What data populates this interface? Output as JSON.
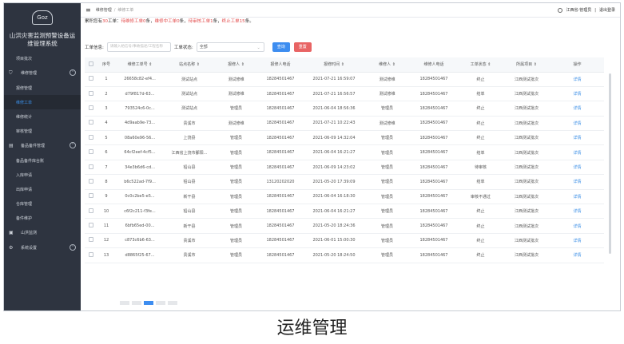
{
  "app": {
    "logo_text": "Goz",
    "system_title": "山洪灾害监测预警设备运维管理系统"
  },
  "sidebar": {
    "items": [
      {
        "label": "项目批次",
        "type": "sub",
        "icon": ""
      },
      {
        "label": "维修管理",
        "type": "group",
        "icon": "shield-icon"
      },
      {
        "label": "报修管理",
        "type": "sub",
        "icon": ""
      },
      {
        "label": "维修工单",
        "type": "sub",
        "icon": "",
        "active": true
      },
      {
        "label": "维修统计",
        "type": "sub",
        "icon": ""
      },
      {
        "label": "审核管理",
        "type": "sub",
        "icon": ""
      },
      {
        "label": "备品备件管理",
        "type": "group",
        "icon": "clipboard-icon"
      },
      {
        "label": "备品备件库台账",
        "type": "sub",
        "icon": ""
      },
      {
        "label": "入库申请",
        "type": "sub",
        "icon": ""
      },
      {
        "label": "出库申请",
        "type": "sub",
        "icon": ""
      },
      {
        "label": "仓库管理",
        "type": "sub",
        "icon": ""
      },
      {
        "label": "备件维护",
        "type": "sub",
        "icon": ""
      },
      {
        "label": "山洪监测",
        "type": "group",
        "icon": "monitor-icon"
      },
      {
        "label": "系统设置",
        "type": "group",
        "icon": "settings-icon"
      }
    ]
  },
  "topbar": {
    "breadcrumb": [
      "维修管理",
      "维修工单"
    ],
    "user": "江西省-管理员",
    "logout": "退出登录"
  },
  "stats": {
    "prefix": "累积您有",
    "total": "30",
    "t1": "工单：",
    "pending_label": "待维修工单",
    "pending_val": "0",
    "repairing_label": "维修中工单",
    "repairing_val": "0",
    "review_label": "待审核工单",
    "review_val": "1",
    "stopped_label": "终止工单",
    "stopped_val": "15",
    "unit": "条",
    "sep": "，"
  },
  "filter": {
    "order_label": "工单信息:",
    "order_placeholder": "请输入始信号/事故描述/工程名称",
    "status_label": "工单状态:",
    "status_value": "全部",
    "search_btn": "查询",
    "reset_btn": "重置"
  },
  "table": {
    "columns": [
      "",
      "序号",
      "维修工单号 ⇕",
      "站点名称 ⇕",
      "报修人 ⇕",
      "报修人电话",
      "报修时间 ⇕",
      "维修人 ⇕",
      "维修人电话",
      "工单状态 ⇕",
      "所属项目 ⇕",
      "操作"
    ],
    "rows": [
      [
        "1",
        "26658c82-ef4...",
        "测试站点",
        "测试修维",
        "18284501467",
        "2021-07-21 16:59:07",
        "测试修维",
        "18284501467",
        "终止",
        "江西测试批次",
        "详情"
      ],
      [
        "2",
        "d79f817d-63...",
        "测试站点",
        "测试修维",
        "18284501467",
        "2021-07-21 16:56:57",
        "测试修维",
        "18284501467",
        "结单",
        "江西测试批次",
        "详情"
      ],
      [
        "3",
        "793524c6-0c...",
        "测试站点",
        "管理员",
        "18284501467",
        "2021-06-04 18:56:36",
        "管理员",
        "18284501467",
        "终止",
        "江西测试批次",
        "详情"
      ],
      [
        "4",
        "4d9aab9e-73...",
        "贵溪市",
        "测试修维",
        "18284501467",
        "2021-07-21 10:22:43",
        "测试修维",
        "18284501467",
        "终止",
        "江西测试批次",
        "详情"
      ],
      [
        "5",
        "08a60e96-56...",
        "上饶县",
        "管理员",
        "18284501467",
        "2021-06-09 14:32:04",
        "管理员",
        "18284501467",
        "终止",
        "江西测试批次",
        "详情"
      ],
      [
        "6",
        "64cf2eef-4cf5...",
        "江西省上饶市鄱阳...",
        "管理员",
        "18284501467",
        "2021-06-04 16:21:27",
        "管理员",
        "18284501467",
        "结单",
        "江西测试批次",
        "详情"
      ],
      [
        "7",
        "34e3b6d6-cd...",
        "铅山县",
        "管理员",
        "18284501467",
        "2021-06-09 14:23:02",
        "管理员",
        "18284501467",
        "待审核",
        "江西测试批次",
        "详情"
      ],
      [
        "8",
        "b6c522ad-7f9...",
        "铅山县",
        "管理员",
        "13120202020",
        "2021-05-20 17:39:09",
        "管理员",
        "18284501467",
        "结单",
        "江西测试批次",
        "详情"
      ],
      [
        "9",
        "0c0c2be5-e5...",
        "新干县",
        "管理员",
        "18284501467",
        "2021-06-04 16:18:30",
        "管理员",
        "18284501467",
        "审核不通过",
        "江西测试批次",
        "详情"
      ],
      [
        "10",
        "c6f2c211-f3fe...",
        "铅山县",
        "管理员",
        "18284501467",
        "2021-06-04 16:21:27",
        "管理员",
        "18284501467",
        "终止",
        "江西测试批次",
        "详情"
      ],
      [
        "11",
        "6bfb65ed-00...",
        "新干县",
        "管理员",
        "18284501467",
        "2021-05-20 18:24:36",
        "管理员",
        "18284501467",
        "终止",
        "江西测试批次",
        "详情"
      ],
      [
        "12",
        "c873c6b6-63...",
        "贵溪市",
        "管理员",
        "18284501467",
        "2021-06-01 15:00:30",
        "管理员",
        "18284501467",
        "终止",
        "江西测试批次",
        "详情"
      ],
      [
        "13",
        "d8865f25-67...",
        "贵溪市",
        "管理员",
        "18284501467",
        "2021-05-20 18:24:50",
        "管理员",
        "18284501467",
        "终止",
        "江西测试批次",
        "详情"
      ]
    ]
  },
  "caption": "运维管理",
  "colors": {
    "sidebar_bg": "#2e3440",
    "accent": "#3d8df0",
    "danger": "#e34d4d"
  }
}
